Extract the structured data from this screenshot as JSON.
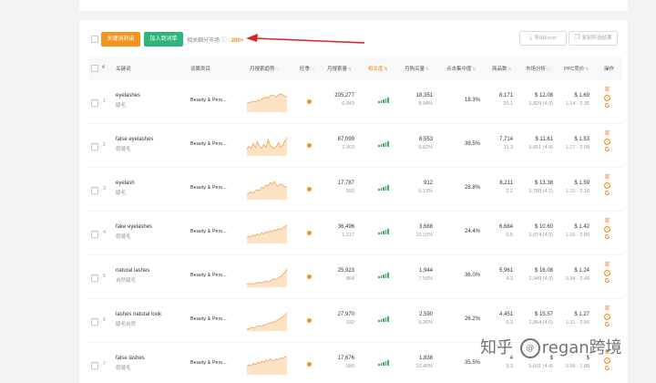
{
  "toolbar": {
    "keyword_button": "关键词转出",
    "add_button": "加入到词单",
    "market_label": "相关细分市场",
    "market_info": "ⓘ",
    "market_value": "200+",
    "export_excel": "导出Excel",
    "copy_text": "复制所选结果"
  },
  "columns": [
    {
      "key": "index",
      "label": "#"
    },
    {
      "key": "keyword",
      "label": "关键词"
    },
    {
      "key": "category",
      "label": "词属类目"
    },
    {
      "key": "trend",
      "label": "月搜索趋势"
    },
    {
      "key": "season",
      "label": "旺季"
    },
    {
      "key": "search_volume",
      "label": "月搜索量"
    },
    {
      "key": "relevance",
      "label": "相关度"
    },
    {
      "key": "purchase",
      "label": "月购买量"
    },
    {
      "key": "click_share",
      "label": "点击集中度"
    },
    {
      "key": "products",
      "label": "商品数"
    },
    {
      "key": "market",
      "label": "市场分析"
    },
    {
      "key": "ppc",
      "label": "PPC竞价"
    },
    {
      "key": "ops",
      "label": "操作"
    }
  ],
  "rows": [
    {
      "index": "1",
      "keyword": "eyelashes",
      "keyword_cn": "睫毛",
      "category": "Beauty & Pers...",
      "search_volume": "205,277",
      "search_sub": "6,843",
      "purchase": "18,351",
      "purchase_rate": "8.94%",
      "click_share": "18.3%",
      "products": "8,171",
      "products_sub": "25.1",
      "market_price": "$ 12.08",
      "market_sub": "3,829 (4.3)",
      "ppc": "$ 1.69",
      "ppc_range": "1.14 - 3.35",
      "trend": [
        9,
        8,
        9,
        10,
        9,
        11,
        10,
        12,
        13,
        14,
        13,
        15,
        16,
        15,
        14,
        16,
        17,
        16,
        15,
        14
      ],
      "bars": [
        2,
        3,
        4,
        5,
        6
      ]
    },
    {
      "index": "2",
      "keyword": "false eyelashes",
      "keyword_cn": "假睫毛",
      "category": "Beauty & Pers...",
      "search_volume": "87,099",
      "search_sub": "2,903",
      "purchase": "8,553",
      "purchase_rate": "9.82%",
      "click_share": "39.5%",
      "products": "7,714",
      "products_sub": "11.3",
      "market_price": "$ 11.61",
      "market_sub": "5,661 (4.4)",
      "ppc": "$ 1.53",
      "ppc_range": "1.17 - 3.08",
      "trend": [
        6,
        9,
        7,
        12,
        8,
        14,
        9,
        7,
        11,
        8,
        16,
        10,
        8,
        7,
        9,
        13,
        8,
        10,
        15,
        18
      ],
      "bars": [
        2,
        3,
        4,
        5,
        6
      ]
    },
    {
      "index": "3",
      "keyword": "eyelash",
      "keyword_cn": "睫毛",
      "category": "Beauty & Pers...",
      "search_volume": "17,787",
      "search_sub": "593",
      "purchase": "912",
      "purchase_rate": "5.13%",
      "click_share": "28.8%",
      "products": "8,211",
      "products_sub": "2.2",
      "market_price": "$ 13.38",
      "market_sub": "3,788 (4.2)",
      "ppc": "$ 1.59",
      "ppc_range": "1.10 - 3.18",
      "trend": [
        4,
        5,
        6,
        5,
        7,
        8,
        7,
        10,
        9,
        12,
        11,
        14,
        13,
        15,
        12,
        11,
        13,
        12,
        10,
        11
      ],
      "bars": [
        2,
        3,
        4,
        5,
        6
      ]
    },
    {
      "index": "4",
      "keyword": "fake eyelashes",
      "keyword_cn": "假睫毛",
      "category": "Beauty & Pers...",
      "search_volume": "36,496",
      "search_sub": "1,217",
      "purchase": "3,688",
      "purchase_rate": "10.10%",
      "click_share": "24.4%",
      "products": "6,684",
      "products_sub": "5.5",
      "market_price": "$ 10.60",
      "market_sub": "3,674 (4.3)",
      "ppc": "$ 1.42",
      "ppc_range": "1.16 - 2.86",
      "trend": [
        5,
        6,
        5,
        7,
        6,
        8,
        7,
        9,
        8,
        10,
        9,
        11,
        10,
        12,
        11,
        13,
        12,
        14,
        15,
        16
      ],
      "bars": [
        2,
        3,
        4,
        5,
        6
      ]
    },
    {
      "index": "5",
      "keyword": "natural lashes",
      "keyword_cn": "自然睫毛",
      "category": "Beauty & Pers...",
      "search_volume": "25,923",
      "search_sub": "864",
      "purchase": "1,944",
      "purchase_rate": "7.50%",
      "click_share": "36.0%",
      "products": "5,961",
      "products_sub": "4.3",
      "market_price": "$ 16.08",
      "market_sub": "2,949 (4.3)",
      "ppc": "$ 1.24",
      "ppc_range": "0.94 - 2.49",
      "trend": [
        2,
        2,
        3,
        2,
        3,
        3,
        4,
        3,
        4,
        5,
        4,
        5,
        6,
        7,
        6,
        8,
        9,
        11,
        13,
        16
      ],
      "bars": [
        2,
        3,
        4,
        5,
        6
      ]
    },
    {
      "index": "6",
      "keyword": "lashes natural look",
      "keyword_cn": "睫毛自然",
      "category": "Beauty & Pers...",
      "search_volume": "27,970",
      "search_sub": "932",
      "purchase": "2,590",
      "purchase_rate": "9.26%",
      "click_share": "26.2%",
      "products": "4,451",
      "products_sub": "6.3",
      "market_price": "$ 15.57",
      "market_sub": "2,864 (4.6)",
      "ppc": "$ 1.27",
      "ppc_range": "1.11 - 2.56",
      "trend": [
        1,
        1,
        2,
        2,
        2,
        3,
        3,
        3,
        4,
        4,
        5,
        5,
        6,
        6,
        7,
        8,
        9,
        10,
        11,
        13
      ],
      "bars": [
        2,
        3,
        4,
        5,
        6
      ]
    },
    {
      "index": "7",
      "keyword": "false lashes",
      "keyword_cn": "假睫毛",
      "category": "Beauty & Pers...",
      "search_volume": "17,676",
      "search_sub": "589",
      "purchase": "1,838",
      "purchase_rate": "10.40%",
      "click_share": "35.5%",
      "products": "4",
      "products_sub": "3.3",
      "market_price": "$",
      "market_sub": "5,601 (4.4)",
      "ppc": "$",
      "ppc_range": "0.99 - 1.88",
      "trend": [
        6,
        8,
        7,
        9,
        8,
        10,
        9,
        11,
        10,
        12,
        11,
        13,
        12,
        11,
        13,
        12,
        14,
        13,
        15,
        14
      ],
      "bars": [
        2,
        3,
        4,
        5,
        6
      ]
    }
  ],
  "watermark": {
    "prefix": "知乎",
    "suffix": "regan跨境",
    "logo": "@"
  }
}
